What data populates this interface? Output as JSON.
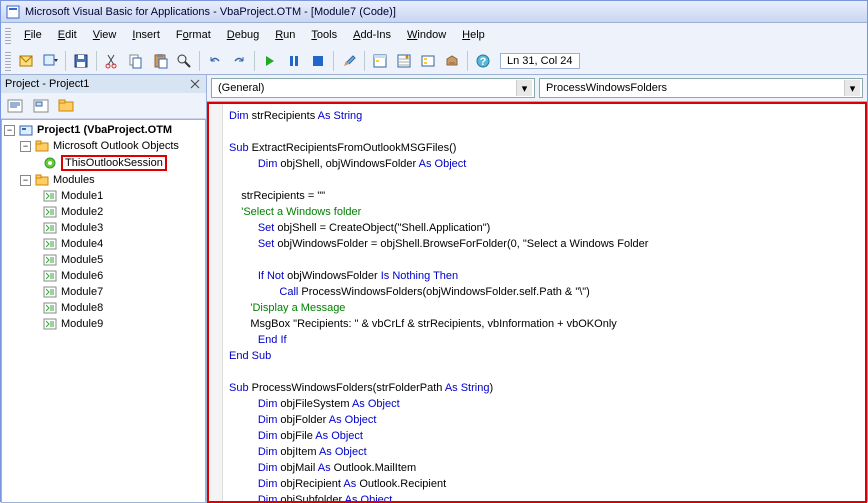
{
  "window": {
    "title": "Microsoft Visual Basic for Applications - VbaProject.OTM - [Module7 (Code)]"
  },
  "menu": {
    "file": "File",
    "edit": "Edit",
    "view": "View",
    "insert": "Insert",
    "format": "Format",
    "debug": "Debug",
    "run": "Run",
    "tools": "Tools",
    "addins": "Add-Ins",
    "window": "Window",
    "help": "Help"
  },
  "toolbar": {
    "status": "Ln 31, Col 24"
  },
  "project": {
    "panel_title": "Project - Project1",
    "root": "Project1 (VbaProject.OTM",
    "folder1": "Microsoft Outlook Objects",
    "session": "ThisOutlookSession",
    "folder2": "Modules",
    "modules": [
      "Module1",
      "Module2",
      "Module3",
      "Module4",
      "Module5",
      "Module6",
      "Module7",
      "Module8",
      "Module9"
    ]
  },
  "code_header": {
    "left": "(General)",
    "right": "ProcessWindowsFolders"
  },
  "code": {
    "l01a": "Dim",
    "l01b": " strRecipients ",
    "l01c": "As String",
    "l02a": "Sub",
    "l02b": " ExtractRecipientsFromOutlookMSGFiles()",
    "l03a": "Dim",
    "l03b": " objShell, objWindowsFolder ",
    "l03c": "As Object",
    "l04": "    strRecipients = \"\"",
    "l05": "    'Select a Windows folder",
    "l06a": "Set",
    "l06b": " objShell = CreateObject(\"Shell.Application\")",
    "l07a": "Set",
    "l07b": " objWindowsFolder = objShell.BrowseForFolder(0, \"Select a Windows Folder",
    "l08a": "If Not",
    "l08b": " objWindowsFolder ",
    "l08c": "Is Nothing Then",
    "l09a": "Call",
    "l09b": " ProcessWindowsFolders(objWindowsFolder.self.Path & \"\\\")",
    "l10": "       'Display a Message",
    "l11": "       MsgBox \"Recipients: \" & vbCrLf & strRecipients, vbInformation + vbOKOnly",
    "l12": "End If",
    "l13": "End Sub",
    "l14a": "Sub",
    "l14b": " ProcessWindowsFolders(strFolderPath ",
    "l14c": "As String",
    "l14d": ")",
    "l15a": "Dim",
    "l15b": " objFileSystem ",
    "l15c": "As Object",
    "l16a": "Dim",
    "l16b": " objFolder ",
    "l16c": "As Object",
    "l17a": "Dim",
    "l17b": " objFile ",
    "l17c": "As Object",
    "l18a": "Dim",
    "l18b": " objItem ",
    "l18c": "As Object",
    "l19a": "Dim",
    "l19b": " objMail ",
    "l19c": "As",
    "l19d": " Outlook.MailItem",
    "l20a": "Dim",
    "l20b": " objRecipient ",
    "l20c": "As",
    "l20d": " Outlook.Recipient",
    "l21a": "Dim",
    "l21b": " objSubfolder ",
    "l21c": "As Object"
  }
}
